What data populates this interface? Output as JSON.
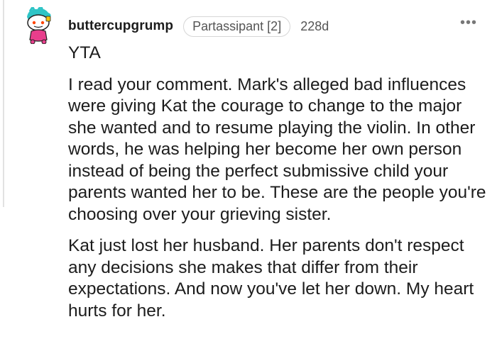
{
  "comment": {
    "username": "buttercupgrump",
    "flair": "Partassipant [2]",
    "age": "228d",
    "more_icon": "more-options-icon",
    "avatar_icon": "snoo-avatar-icon",
    "paragraphs": [
      "YTA",
      "I read your comment. Mark's alleged bad influences were giving Kat the courage to change to the major she wanted and to resume playing the violin. In other words, he was helping her become her own person instead of being the perfect submissive child your parents wanted her to be. These are the people you're choosing over your grieving sister.",
      "Kat just lost her husband. Her parents don't respect any decisions she makes that differ from their expectations. And now you've let her down. My heart hurts for her."
    ]
  },
  "colors": {
    "text": "#1c1c1c",
    "meta": "#555555",
    "thread_line": "#e2e2e2",
    "avatar_hair": "#2ec4c6",
    "avatar_shirt": "#e83e8c"
  }
}
